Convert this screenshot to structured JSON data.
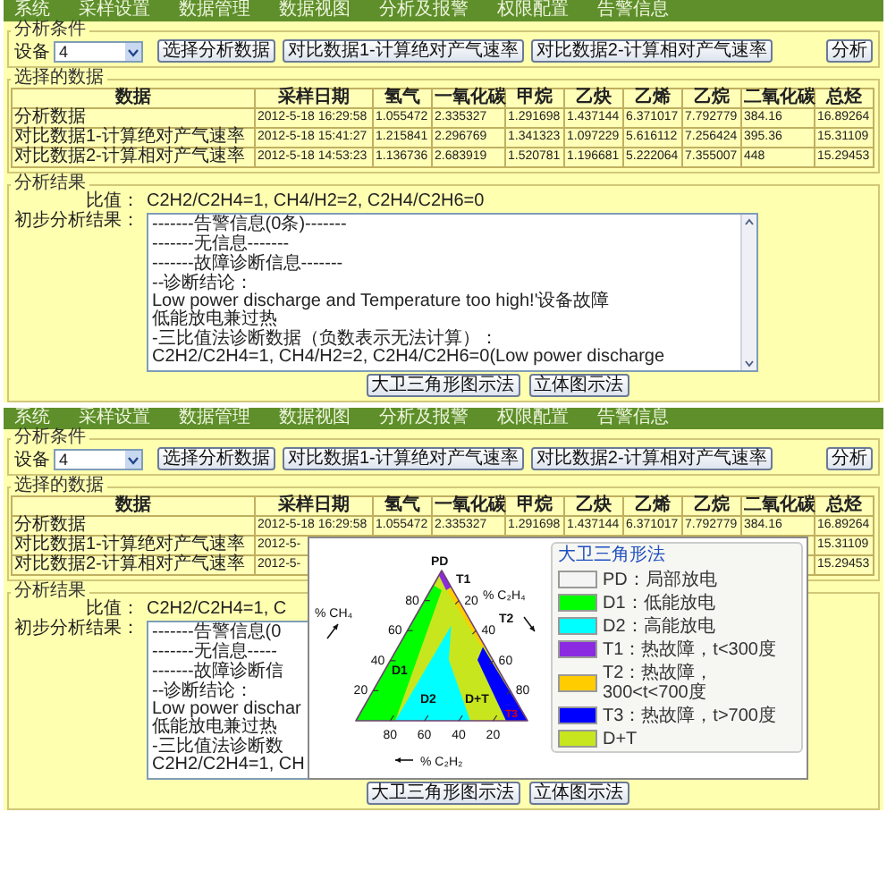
{
  "screens": [
    {
      "menu": [
        "系统",
        "采样设置",
        "数据管理",
        "数据视图",
        "分析及报警",
        "权限配置",
        "告警信息"
      ],
      "conditions": {
        "legend": "分析条件",
        "device_label": "设备",
        "device_value": "4",
        "buttons": [
          "选择分析数据",
          "对比数据1-计算绝对产气速率",
          "对比数据2-计算相对产气速率",
          "分析"
        ]
      },
      "data_table": {
        "legend": "选择的数据",
        "columns": [
          "数据",
          "采样日期",
          "氢气",
          "一氧化碳",
          "甲烷",
          "乙炔",
          "乙烯",
          "乙烷",
          "二氧化碳",
          "总烃"
        ],
        "rows": [
          {
            "data": "分析数据",
            "date": "2012-5-18 16:29:58",
            "values": [
              "1.055472",
              "2.335327",
              "1.291698",
              "1.437144",
              "6.371017",
              "7.792779",
              "384.16"
            ],
            "total": "16.89264"
          },
          {
            "data": "对比数据1-计算绝对产气速率",
            "date": "2012-5-18 15:41:27",
            "values": [
              "1.215841",
              "2.296769",
              "1.341323",
              "1.097229",
              "5.616112",
              "7.256424",
              "395.36"
            ],
            "total": "15.31109"
          },
          {
            "data": "对比数据2-计算相对产气速率",
            "date": "2012-5-18 14:53:23",
            "values": [
              "1.136736",
              "2.683919",
              "1.520781",
              "1.196681",
              "5.222064",
              "7.355007",
              "448"
            ],
            "total": "15.29453"
          }
        ]
      },
      "results": {
        "legend": "分析结果",
        "ratio_label": "比值：",
        "ratio": "C2H2/C2H4=1, CH4/H2=2, C2H4/C2H6=0",
        "preliminary_label": "初步分析结果：",
        "paragraphs": [
          [
            "-------告警信息(0条)-------"
          ],
          [
            "-------无信息-------"
          ],
          [
            "-------故障诊断信息-------"
          ],
          [
            "--诊断结论：",
            "Low power discharge and Temperature too high!'设备故障",
            "低能放电兼过热"
          ],
          [
            "-三比值法诊断数据（负数表示无法计算）：",
            "C2H2/C2H4=1, CH4/H2=2, C2H4/C2H6=0(Low power discharge"
          ]
        ],
        "buttons": [
          "大卫三角形图示法",
          "立体图示法"
        ]
      }
    },
    {
      "menu": [
        "系统",
        "采样设置",
        "数据管理",
        "数据视图",
        "分析及报警",
        "权限配置",
        "告警信息"
      ],
      "conditions": {
        "legend": "分析条件",
        "device_label": "设备",
        "device_value": "4",
        "buttons": [
          "选择分析数据",
          "对比数据1-计算绝对产气速率",
          "对比数据2-计算相对产气速率",
          "分析"
        ]
      },
      "data_table": {
        "legend": "选择的数据",
        "columns": [
          "数据",
          "采样日期",
          "氢气",
          "一氧化碳",
          "甲烷",
          "乙炔",
          "乙烯",
          "乙烷",
          "二氧化碳",
          "总烃"
        ],
        "rows": [
          {
            "data": "分析数据",
            "date": "2012-5-18 16:29:58",
            "values": [
              "1.055472",
              "2.335327",
              "1.291698",
              "1.437144",
              "6.371017",
              "7.792779",
              "384.16"
            ],
            "total": "16.89264"
          },
          {
            "data": "对比数据1-计算绝对产气速率",
            "date": "2012-5-",
            "total": "15.31109"
          },
          {
            "data": "对比数据2-计算相对产气速率",
            "date": "2012-5-",
            "total": "15.29453"
          }
        ]
      },
      "results": {
        "legend": "分析结果",
        "ratio_label": "比值：",
        "ratio": "C2H2/C2H4=1, C",
        "preliminary_label": "初步分析结果：",
        "paragraphs": [
          [
            "-------告警信息(0"
          ],
          [
            "-------无信息-----"
          ],
          [
            "-------故障诊断信"
          ],
          [
            "--诊断结论：",
            "Low power dischar",
            "低能放电兼过热"
          ],
          [
            "-三比值法诊断数",
            "C2H2/C2H4=1, CH"
          ]
        ],
        "buttons": [
          "大卫三角形图示法",
          "立体图示法"
        ]
      },
      "popup": {
        "region_labels": [
          "PD",
          "T1",
          "T2",
          "T3",
          "D1",
          "D2",
          "D+T"
        ],
        "left_axis": {
          "label": "% CH₄",
          "ticks": [
            "80",
            "60",
            "40",
            "20"
          ]
        },
        "right_axis": {
          "label": "% C₂H₄",
          "ticks": [
            "20",
            "40",
            "60",
            "80"
          ]
        },
        "bottom_axis": {
          "label": "% C₂H₂",
          "ticks": [
            "80",
            "60",
            "40",
            "20"
          ]
        },
        "legend": {
          "title": "大卫三角形法",
          "items": [
            {
              "label": "PD：局部放电",
              "color": "#f4f4f4"
            },
            {
              "label": "D1：低能放电",
              "color": "#00ff00"
            },
            {
              "label": "D2：高能放电",
              "color": "#00ffff"
            },
            {
              "label": "T1：热故障，t<300度",
              "color": "#8a2be2"
            },
            {
              "label": "T2：热故障，300<t<700度",
              "color": "#ffcc00"
            },
            {
              "label": "T3：热故障，t>700度",
              "color": "#0000ff"
            },
            {
              "label": "D+T",
              "color": "#c8e61e"
            }
          ]
        }
      }
    }
  ]
}
